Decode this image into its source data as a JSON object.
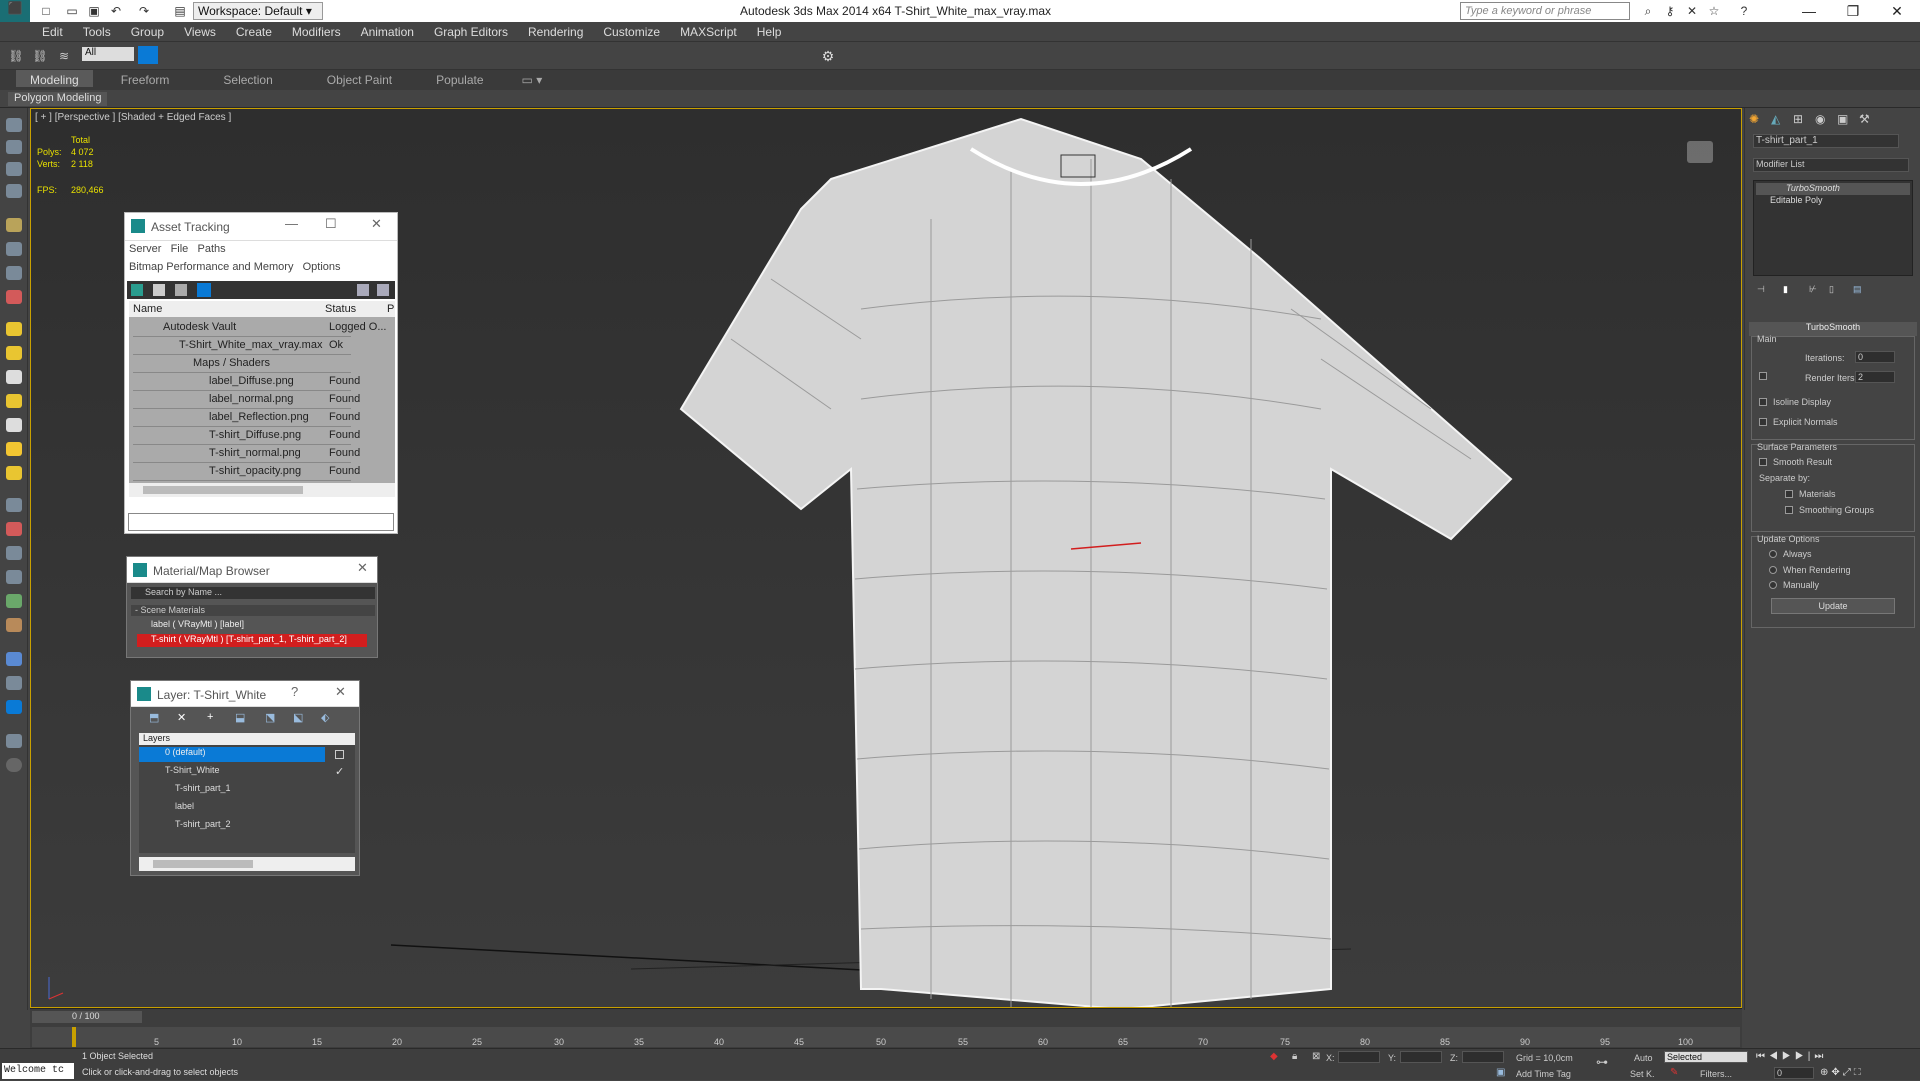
{
  "titlebar": {
    "workspace": "Workspace: Default",
    "title": "Autodesk 3ds Max  2014 x64     T-Shirt_White_max_vray.max",
    "search_placeholder": "Type a keyword or phrase"
  },
  "menu": [
    "Edit",
    "Tools",
    "Group",
    "Views",
    "Create",
    "Modifiers",
    "Animation",
    "Graph Editors",
    "Rendering",
    "Customize",
    "MAXScript",
    "Help"
  ],
  "maintoolbar": {
    "selection_filter": "All"
  },
  "ribbon": {
    "tabs": [
      "Modeling",
      "Freeform",
      "Selection",
      "Object Paint",
      "Populate"
    ],
    "sub": "Polygon Modeling"
  },
  "viewport": {
    "label": "[ + ] [Perspective ] [Shaded + Edged Faces ]",
    "stats": {
      "total": "Total",
      "polys_label": "Polys:",
      "polys": "4 072",
      "verts_label": "Verts:",
      "verts": "2 118",
      "fps_label": "FPS:",
      "fps": "280,466"
    }
  },
  "asset_tracking": {
    "title": "Asset Tracking",
    "menu": [
      "Server",
      "File",
      "Paths"
    ],
    "menu2": [
      "Bitmap Performance and Memory",
      "Options"
    ],
    "col_name": "Name",
    "col_status": "Status",
    "col_p": "P",
    "rows": [
      {
        "name": "Autodesk Vault",
        "status": "Logged O..."
      },
      {
        "name": "T-Shirt_White_max_vray.max",
        "status": "Ok"
      },
      {
        "name": "Maps / Shaders",
        "status": ""
      },
      {
        "name": "label_Diffuse.png",
        "status": "Found"
      },
      {
        "name": "label_normal.png",
        "status": "Found"
      },
      {
        "name": "label_Reflection.png",
        "status": "Found"
      },
      {
        "name": "T-shirt_Diffuse.png",
        "status": "Found"
      },
      {
        "name": "T-shirt_normal.png",
        "status": "Found"
      },
      {
        "name": "T-shirt_opacity.png",
        "status": "Found"
      }
    ]
  },
  "material_browser": {
    "title": "Material/Map Browser",
    "search": "Search by Name ...",
    "section": "- Scene Materials",
    "items": [
      "label  ( VRayMtl )  [label]",
      "T-shirt  ( VRayMtl )  [T-shirt_part_1, T-shirt_part_2]"
    ]
  },
  "layer": {
    "title": "Layer: T-Shirt_White",
    "header": "Layers",
    "items": [
      "0 (default)",
      "T-Shirt_White",
      "T-shirt_part_1",
      "label",
      "T-shirt_part_2"
    ]
  },
  "command_panel": {
    "object_name": "T-shirt_part_1",
    "modifier_list": "Modifier List",
    "stack": [
      "TurboSmooth",
      "Editable Poly"
    ],
    "rollout": "TurboSmooth",
    "main": "Main",
    "iterations_label": "Iterations:",
    "iterations": "0",
    "render_iters_label": "Render Iters:",
    "render_iters": "2",
    "isoline": "Isoline Display",
    "explicit": "Explicit Normals",
    "surface": "Surface Parameters",
    "smooth_result": "Smooth Result",
    "separate": "Separate by:",
    "materials": "Materials",
    "smoothing_groups": "Smoothing Groups",
    "update_options": "Update Options",
    "always": "Always",
    "when_rendering": "When Rendering",
    "manually": "Manually",
    "update": "Update"
  },
  "timeline": {
    "frame": "0 / 100",
    "ticks": [
      "5",
      "10",
      "15",
      "20",
      "25",
      "30",
      "35",
      "40",
      "45",
      "50",
      "55",
      "60",
      "65",
      "70",
      "75",
      "80",
      "85",
      "90",
      "95",
      "100"
    ]
  },
  "status": {
    "welcome": "Welcome tc",
    "selected": "1 Object Selected",
    "hint": "Click or click-and-drag to select objects",
    "x": "X:",
    "y": "Y:",
    "z": "Z:",
    "grid": "Grid = 10,0cm",
    "auto": "Auto",
    "set_key": "Set K.",
    "key_filter": "Selected",
    "filters": "Filters...",
    "add_time_tag": "Add Time Tag",
    "frame_field": "0"
  },
  "colors": {
    "accent": "#0a7ad6",
    "viewport_border": "#c8a000",
    "selection_red": "#d21e1e"
  }
}
